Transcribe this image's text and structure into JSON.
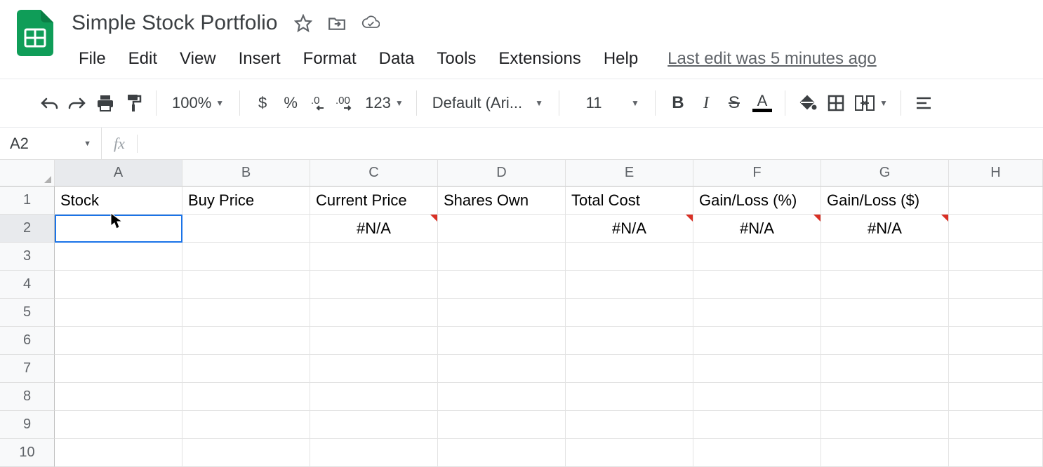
{
  "doc": {
    "title": "Simple Stock Portfolio",
    "last_edit": "Last edit was 5 minutes ago"
  },
  "menu": {
    "file": "File",
    "edit": "Edit",
    "view": "View",
    "insert": "Insert",
    "format": "Format",
    "data": "Data",
    "tools": "Tools",
    "extensions": "Extensions",
    "help": "Help"
  },
  "toolbar": {
    "zoom": "100%",
    "currency": "$",
    "percent": "%",
    "dec_dec": ".0",
    "inc_dec": ".00",
    "numfmt": "123",
    "font": "Default (Ari...",
    "font_size": "11",
    "bold": "B",
    "italic": "I",
    "strike": "S",
    "textcolor": "A"
  },
  "namebox": {
    "ref": "A2"
  },
  "formula": {
    "fx": "fx",
    "value": ""
  },
  "columns": [
    "A",
    "B",
    "C",
    "D",
    "E",
    "F",
    "G",
    "H"
  ],
  "grid": {
    "headers": [
      "Stock",
      "Buy Price",
      "Current Price",
      "Shares Own",
      "Total Cost",
      "Gain/Loss (%)",
      "Gain/Loss ($)"
    ],
    "row2": {
      "A": "",
      "B": "",
      "C": "#N/A",
      "D": "",
      "E": "#N/A",
      "F": "#N/A",
      "G": "#N/A"
    },
    "selected_cell": "A2",
    "row_count": 10
  }
}
